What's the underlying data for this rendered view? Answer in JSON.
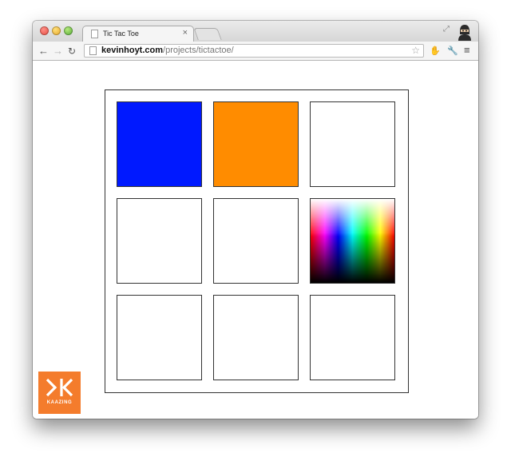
{
  "browser": {
    "tab": {
      "title": "Tic Tac Toe",
      "close_glyph": "×"
    },
    "address": {
      "host": "kevinhoyt.com",
      "path": "/projects/tictactoe/"
    },
    "icons": {
      "back": "back-arrow-icon",
      "forward": "forward-arrow-icon",
      "reload": "reload-icon",
      "star": "bookmark-star-icon",
      "extension": "extension-icon",
      "wrench": "wrench-icon",
      "menu": "menu-icon"
    }
  },
  "game": {
    "cells": [
      {
        "state": "blue",
        "color": "#0019ff"
      },
      {
        "state": "orange",
        "color": "#ff8c00"
      },
      {
        "state": "empty",
        "color": "#ffffff"
      },
      {
        "state": "empty",
        "color": "#ffffff"
      },
      {
        "state": "empty",
        "color": "#ffffff"
      },
      {
        "state": "color-picker",
        "color": ""
      },
      {
        "state": "empty",
        "color": "#ffffff"
      },
      {
        "state": "empty",
        "color": "#ffffff"
      },
      {
        "state": "empty",
        "color": "#ffffff"
      }
    ]
  },
  "logo": {
    "text": "KAAZING",
    "color": "#f47c2c"
  }
}
